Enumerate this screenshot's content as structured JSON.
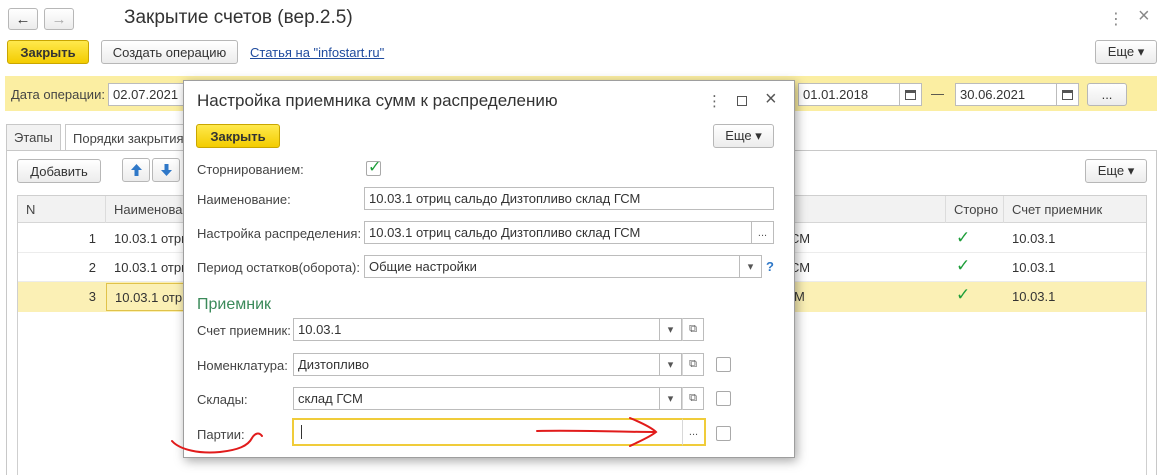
{
  "window": {
    "title": "Закрытие счетов (вер.2.5)",
    "nav_back": "←",
    "nav_forward": "→",
    "menu_icon": "⋮",
    "close_icon": "×"
  },
  "toolbar": {
    "close_label": "Закрыть",
    "create_op_label": "Создать операцию",
    "article_link": "Статья на \"infostart.ru\"",
    "more_label": "Еще ▾"
  },
  "params": {
    "date_label": "Дата операции:",
    "date_value": "02.07.2021",
    "period_from": "01.01.2018",
    "period_dash": "—",
    "period_to": "30.06.2021",
    "dots": "..."
  },
  "tabs": [
    {
      "label": "Этапы"
    },
    {
      "label": "Порядки закрытия"
    }
  ],
  "table_toolbar": {
    "add_label": "Добавить",
    "more_label": "Еще ▾"
  },
  "table": {
    "headers": {
      "n": "N",
      "name": "Наименование",
      "storno": "Сторно",
      "account": "Счет приемник"
    },
    "rows": [
      {
        "n": "1",
        "name": "10.03.1 отриц",
        "mid": "СМ",
        "account": "10.03.1"
      },
      {
        "n": "2",
        "name": "10.03.1 отриц",
        "mid": "СМ",
        "account": "10.03.1"
      },
      {
        "n": "3",
        "name": "10.03.1 отриц",
        "mid": "М",
        "account": "10.03.1"
      }
    ]
  },
  "dialog": {
    "title": "Настройка приемника сумм к распределению",
    "close_label": "Закрыть",
    "more_label": "Еще ▾",
    "storno_label": "Сторнированием:",
    "name_label": "Наименование:",
    "name_value": "10.03.1 отриц сальдо Дизтопливо склад ГСМ",
    "dist_label": "Настройка распределения:",
    "dist_value": "10.03.1 отриц сальдо Дизтопливо склад ГСМ",
    "period_label": "Период остатков(оборота):",
    "period_value": "Общие настройки",
    "help": "?",
    "section_title": "Приемник",
    "account_label": "Счет приемник:",
    "account_value": "10.03.1",
    "nomen_label": "Номенклатура:",
    "nomen_value": "Дизтопливо",
    "warehouse_label": "Склады:",
    "warehouse_value": "склад ГСМ",
    "batch_label": "Партии:",
    "batch_value": "",
    "dots": "...",
    "dropdown": "▾",
    "open": "⧉"
  },
  "colors": {
    "accent_yellow": "#fbe85c",
    "section_green": "#3b8a5a",
    "annotation_red": "#e11b1b"
  }
}
